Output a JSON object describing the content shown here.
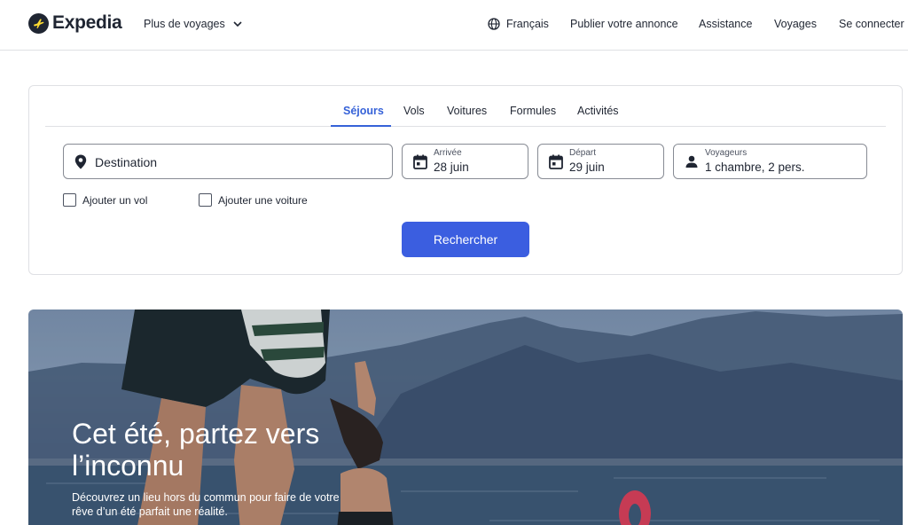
{
  "header": {
    "brand": "Expedia",
    "more_trips": "Plus de voyages",
    "language": "Français",
    "post_listing": "Publier votre annonce",
    "support": "Assistance",
    "trips": "Voyages",
    "sign_in": "Se connecter"
  },
  "search": {
    "tabs": [
      {
        "label": "Séjours",
        "active": true
      },
      {
        "label": "Vols",
        "active": false
      },
      {
        "label": "Voitures",
        "active": false
      },
      {
        "label": "Formules",
        "active": false
      },
      {
        "label": "Activités",
        "active": false
      }
    ],
    "destination": {
      "placeholder": "Destination",
      "icon": "map-pin-icon"
    },
    "checkin": {
      "label": "Arrivée",
      "value": "28 juin",
      "icon": "calendar-icon"
    },
    "checkout": {
      "label": "Départ",
      "value": "29 juin",
      "icon": "calendar-icon"
    },
    "travelers": {
      "label": "Voyageurs",
      "value": "1 chambre, 2 pers.",
      "icon": "person-icon"
    },
    "add_flight": {
      "label": "Ajouter un vol",
      "checked": false
    },
    "add_car": {
      "label": "Ajouter une voiture",
      "checked": false
    },
    "submit": "Rechercher"
  },
  "hero": {
    "title": "Cet été, partez vers l’inconnu",
    "subtitle": "Découvrez un lieu hors du commun pour faire de votre rêve d’un été parfait une réalité."
  },
  "colors": {
    "accent": "#3662d8",
    "button": "#3b5ee0",
    "text": "#1f2532",
    "border": "#dfe0e4"
  }
}
